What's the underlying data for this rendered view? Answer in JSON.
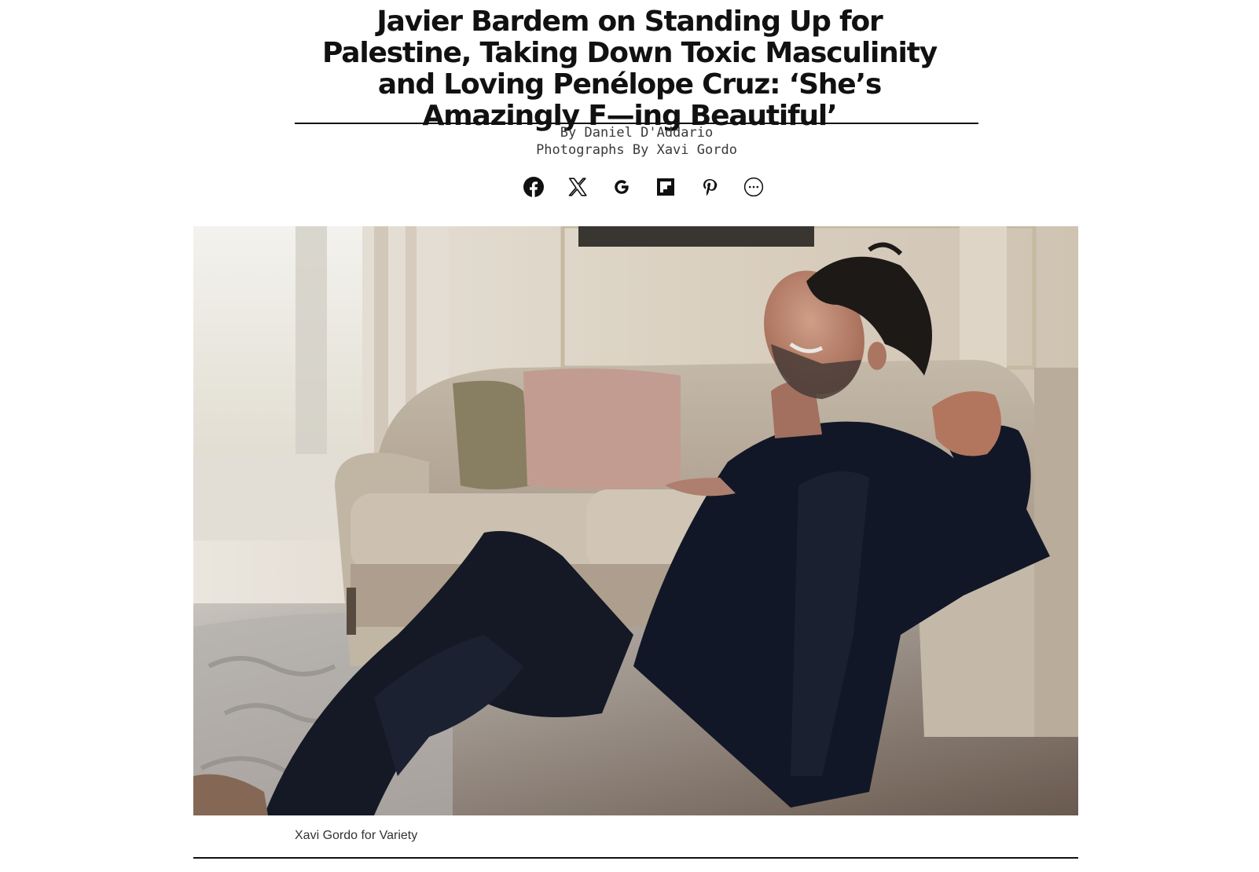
{
  "article": {
    "headline": "Javier Bardem on Standing Up for Palestine, Taking Down Toxic Masculinity and Loving Penélope Cruz: ‘She’s Amazingly F—ing Beautiful’",
    "byline": "By Daniel D'Addario",
    "photo_credit_line": "Photographs By Xavi Gordo"
  },
  "share": {
    "items": [
      {
        "icon": "facebook-icon"
      },
      {
        "icon": "x-icon"
      },
      {
        "icon": "google-icon"
      },
      {
        "icon": "flipboard-icon"
      },
      {
        "icon": "pinterest-icon"
      },
      {
        "icon": "more-icon"
      }
    ]
  },
  "hero_image": {
    "caption": "Xavi Gordo for Variety"
  },
  "colors": {
    "text": "#111111",
    "byline": "#3a3a3a",
    "rule": "#111111",
    "background": "#ffffff"
  }
}
